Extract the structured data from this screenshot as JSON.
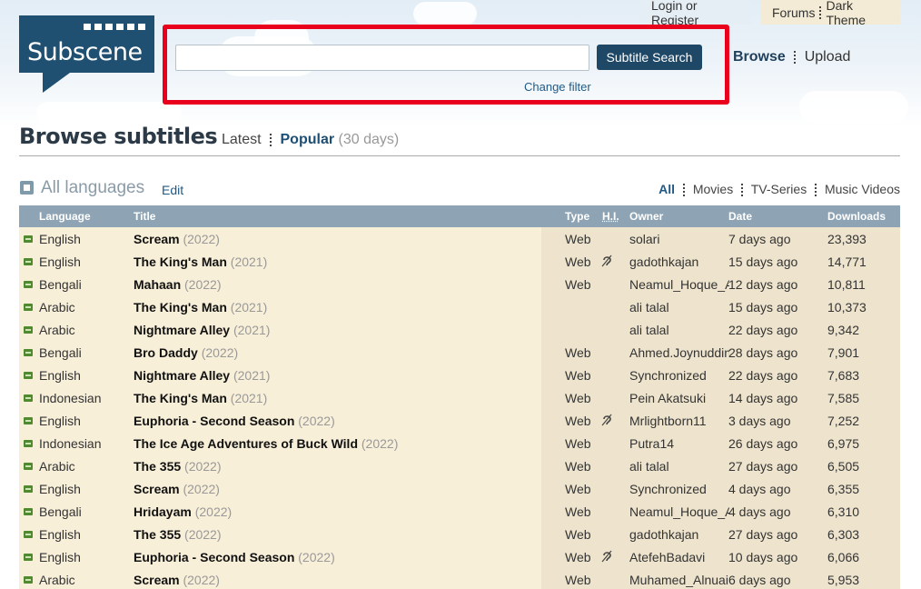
{
  "top_links": {
    "login": "Login or Register",
    "forums": "Forums",
    "theme": "Dark Theme"
  },
  "logo": {
    "text": "Subscene"
  },
  "search": {
    "value": "",
    "placeholder": "",
    "button_label": "Subtitle Search",
    "change_filter": "Change filter",
    "highlight_color": "#e8001c"
  },
  "nav": {
    "browse": "Browse",
    "upload": "Upload"
  },
  "page": {
    "title": "Browse subtitles",
    "tab_latest": "Latest",
    "tab_popular": "Popular",
    "period": "(30 days)"
  },
  "filter": {
    "languages": "All languages",
    "edit": "Edit",
    "types": [
      "All",
      "Movies",
      "TV-Series",
      "Music Videos"
    ]
  },
  "table": {
    "headers": {
      "language": "Language",
      "title": "Title",
      "type": "Type",
      "hi": "H.I.",
      "owner": "Owner",
      "date": "Date",
      "downloads": "Downloads"
    },
    "rows": [
      {
        "language": "English",
        "title": "Scream",
        "year": "(2022)",
        "type": "Web",
        "hi": "",
        "owner": "solari",
        "date": "7 days ago",
        "downloads": "23,393"
      },
      {
        "language": "English",
        "title": "The King's Man",
        "year": "(2021)",
        "type": "Web",
        "hi": "ear-icon",
        "owner": "gadothkajan",
        "date": "15 days ago",
        "downloads": "14,771"
      },
      {
        "language": "Bengali",
        "title": "Mahaan",
        "year": "(2022)",
        "type": "Web",
        "hi": "",
        "owner": "Neamul_Hoque_Al",
        "date": "12 days ago",
        "downloads": "10,811"
      },
      {
        "language": "Arabic",
        "title": "The King's Man",
        "year": "(2021)",
        "type": "",
        "hi": "",
        "owner": "ali talal",
        "date": "15 days ago",
        "downloads": "10,373"
      },
      {
        "language": "Arabic",
        "title": "Nightmare Alley",
        "year": "(2021)",
        "type": "",
        "hi": "",
        "owner": "ali talal",
        "date": "22 days ago",
        "downloads": "9,342"
      },
      {
        "language": "Bengali",
        "title": "Bro Daddy",
        "year": "(2022)",
        "type": "Web",
        "hi": "",
        "owner": "Ahmed.Joynuddin",
        "date": "28 days ago",
        "downloads": "7,901"
      },
      {
        "language": "English",
        "title": "Nightmare Alley",
        "year": "(2021)",
        "type": "Web",
        "hi": "",
        "owner": "Synchronized",
        "date": "22 days ago",
        "downloads": "7,683"
      },
      {
        "language": "Indonesian",
        "title": "The King's Man",
        "year": "(2021)",
        "type": "Web",
        "hi": "",
        "owner": "Pein Akatsuki",
        "date": "14 days ago",
        "downloads": "7,585"
      },
      {
        "language": "English",
        "title": "Euphoria - Second Season",
        "year": "(2022)",
        "type": "Web",
        "hi": "ear-icon",
        "owner": "Mrlightborn11",
        "date": "3 days ago",
        "downloads": "7,252"
      },
      {
        "language": "Indonesian",
        "title": "The Ice Age Adventures of Buck Wild",
        "year": "(2022)",
        "type": "Web",
        "hi": "",
        "owner": "Putra14",
        "date": "26 days ago",
        "downloads": "6,975"
      },
      {
        "language": "Arabic",
        "title": "The 355",
        "year": "(2022)",
        "type": "Web",
        "hi": "",
        "owner": "ali talal",
        "date": "27 days ago",
        "downloads": "6,505"
      },
      {
        "language": "English",
        "title": "Scream",
        "year": "(2022)",
        "type": "Web",
        "hi": "",
        "owner": "Synchronized",
        "date": "4 days ago",
        "downloads": "6,355"
      },
      {
        "language": "Bengali",
        "title": "Hridayam",
        "year": "(2022)",
        "type": "Web",
        "hi": "",
        "owner": "Neamul_Hoque_Al",
        "date": "4 days ago",
        "downloads": "6,310"
      },
      {
        "language": "English",
        "title": "The 355",
        "year": "(2022)",
        "type": "Web",
        "hi": "",
        "owner": "gadothkajan",
        "date": "27 days ago",
        "downloads": "6,303"
      },
      {
        "language": "English",
        "title": "Euphoria - Second Season",
        "year": "(2022)",
        "type": "Web",
        "hi": "ear-icon",
        "owner": "AtefehBadavi",
        "date": "10 days ago",
        "downloads": "6,066"
      },
      {
        "language": "Arabic",
        "title": "Scream",
        "year": "(2022)",
        "type": "Web",
        "hi": "",
        "owner": "Muhamed_Alnuaim",
        "date": "6 days ago",
        "downloads": "5,953"
      }
    ]
  }
}
